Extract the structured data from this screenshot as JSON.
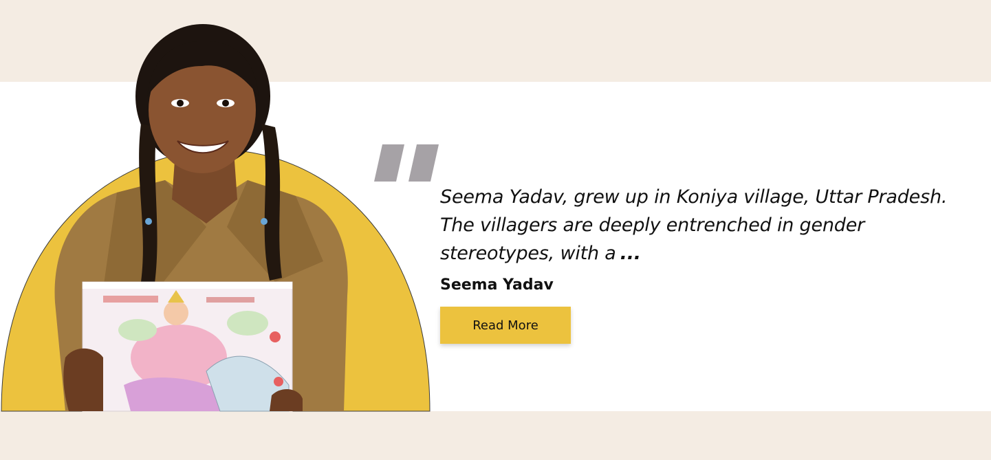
{
  "testimonial": {
    "quote": "Seema Yadav, grew up in Koniya village, Uttar Pradesh. The villagers are deeply entrenched in gender stereotypes, with a",
    "ellipsis": "...",
    "author": "Seema Yadav",
    "button_label": "Read More"
  },
  "colors": {
    "band": "#f4ece3",
    "panel": "#ffffff",
    "accent_yellow": "#ecc23e",
    "quote_mark": "#a6a2a6",
    "text": "#111111"
  },
  "icons": {
    "quote": "quote-mark-icon",
    "photo": "student-portrait-with-drawing"
  }
}
